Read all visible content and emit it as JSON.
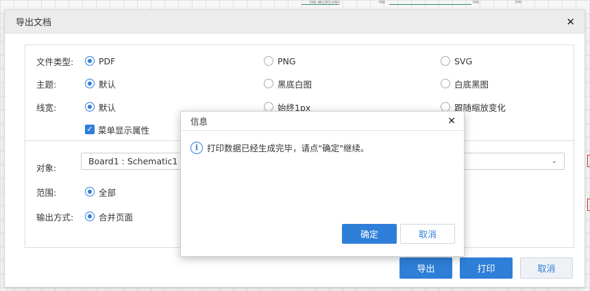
{
  "canvas": {
    "labels": [
      "PAD-WK13P3(PAD)",
      "PBD",
      "PAD",
      "PPD"
    ]
  },
  "export_dialog": {
    "title": "导出文档",
    "close_icon": "close-icon",
    "format": {
      "label": "文件类型:",
      "options": [
        "PDF",
        "PNG",
        "SVG"
      ],
      "selected": "PDF"
    },
    "theme": {
      "label": "主题:",
      "options": [
        "默认",
        "黑底白图",
        "白底黑图"
      ],
      "selected": "默认"
    },
    "line_width": {
      "label": "线宽:",
      "options": [
        "默认",
        "始终1px",
        "跟随缩放变化"
      ],
      "selected": "默认"
    },
    "show_attr": {
      "label": "菜单显示属性",
      "checked": true
    },
    "target": {
      "label": "对象:",
      "value": "Board1 : Schematic1"
    },
    "range": {
      "label": "范围:",
      "selected": "全部"
    },
    "output_mode": {
      "label": "输出方式:",
      "selected": "合并页面"
    },
    "buttons": {
      "export": "导出",
      "print": "打印",
      "cancel": "取消"
    }
  },
  "info_dialog": {
    "title": "信息",
    "message": "打印数据已经生成完毕，请点\"确定\"继续。",
    "icon": "info-icon",
    "buttons": {
      "ok": "确定",
      "cancel": "取消"
    }
  },
  "colors": {
    "accent": "#2f7fd8",
    "header_bg": "#ececec"
  }
}
